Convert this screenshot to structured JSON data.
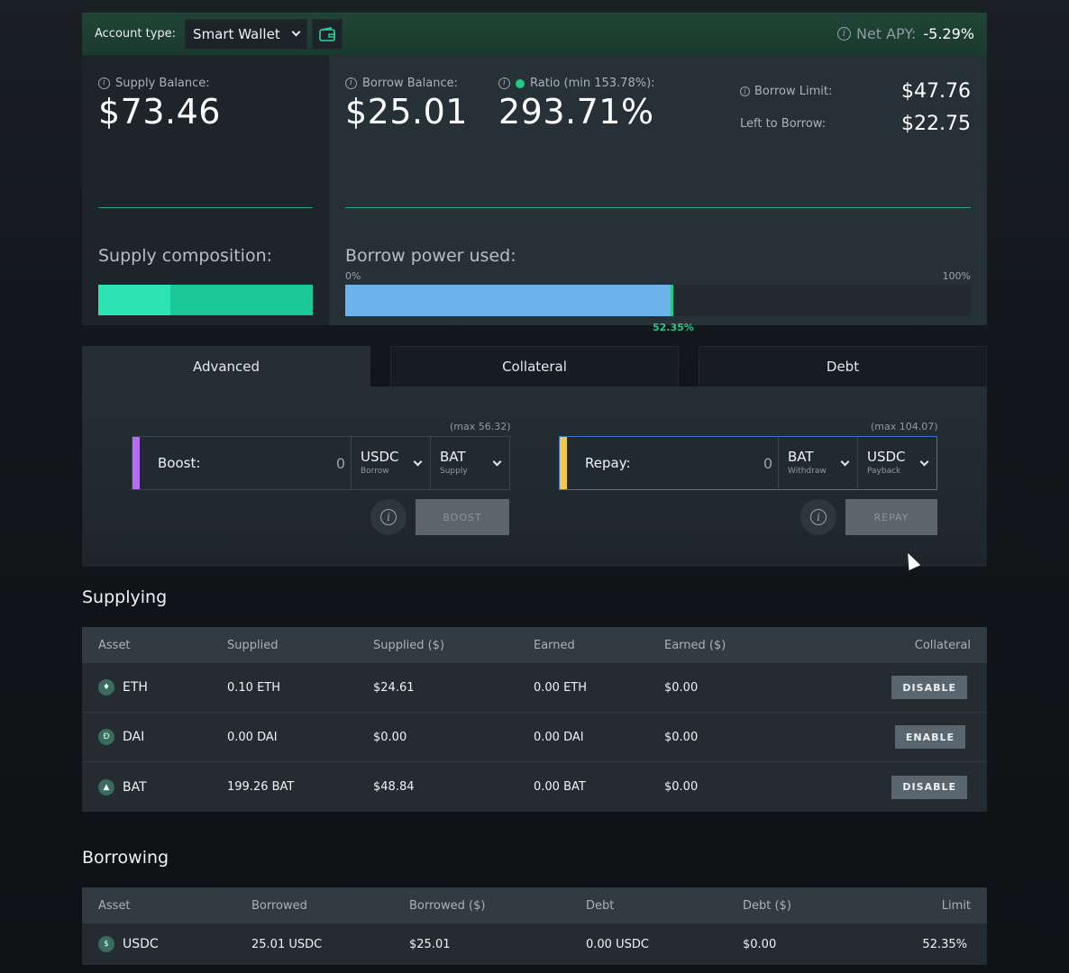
{
  "header": {
    "account_type_label": "Account type:",
    "account_type_value": "Smart Wallet",
    "net_apy_label": "Net APY:",
    "net_apy_value": "-5.29%"
  },
  "stats": {
    "supply_balance_label": "Supply Balance:",
    "supply_balance_value": "$73.46",
    "borrow_balance_label": "Borrow Balance:",
    "borrow_balance_value": "$25.01",
    "ratio_label": "Ratio (min 153.78%):",
    "ratio_value": "293.71%",
    "borrow_limit_label": "Borrow Limit:",
    "borrow_limit_value": "$47.76",
    "left_to_borrow_label": "Left to Borrow:",
    "left_to_borrow_value": "$22.75",
    "supply_composition_label": "Supply composition:",
    "borrow_power_label": "Borrow power used:",
    "borrow_power_min": "0%",
    "borrow_power_max": "100%",
    "borrow_power_value": "52.35%",
    "borrow_power_fraction": 0.5235,
    "supply_composition_fraction_first": 0.335
  },
  "tabs": [
    {
      "label": "Advanced",
      "active": true
    },
    {
      "label": "Collateral",
      "active": false
    },
    {
      "label": "Debt",
      "active": false
    }
  ],
  "boost": {
    "label": "Boost:",
    "amount": "0",
    "max_label": "(max 56.32)",
    "from_asset": "USDC",
    "from_sub": "Borrow",
    "to_asset": "BAT",
    "to_sub": "Supply",
    "button": "BOOST",
    "accent": "#b76cf5"
  },
  "repay": {
    "label": "Repay:",
    "amount": "0",
    "max_label": "(max 104.07)",
    "from_asset": "BAT",
    "from_sub": "Withdraw",
    "to_asset": "USDC",
    "to_sub": "Payback",
    "button": "REPAY",
    "accent": "#f2c94c"
  },
  "supplying": {
    "title": "Supplying",
    "columns": [
      "Asset",
      "Supplied",
      "Supplied ($)",
      "Earned",
      "Earned ($)",
      "Collateral"
    ],
    "rows": [
      {
        "asset": "ETH",
        "icon": "eth-icon",
        "supplied": "0.10 ETH",
        "supplied_usd": "$24.61",
        "earned": "0.00 ETH",
        "earned_usd": "$0.00",
        "action": "DISABLE"
      },
      {
        "asset": "DAI",
        "icon": "dai-icon",
        "supplied": "0.00 DAI",
        "supplied_usd": "$0.00",
        "earned": "0.00 DAI",
        "earned_usd": "$0.00",
        "action": "ENABLE"
      },
      {
        "asset": "BAT",
        "icon": "bat-icon",
        "supplied": "199.26 BAT",
        "supplied_usd": "$48.84",
        "earned": "0.00 BAT",
        "earned_usd": "$0.00",
        "action": "DISABLE"
      }
    ]
  },
  "borrowing": {
    "title": "Borrowing",
    "columns": [
      "Asset",
      "Borrowed",
      "Borrowed ($)",
      "Debt",
      "Debt ($)",
      "Limit"
    ],
    "rows": [
      {
        "asset": "USDC",
        "icon": "usdc-icon",
        "borrowed": "25.01 USDC",
        "borrowed_usd": "$25.01",
        "debt": "0.00 USDC",
        "debt_usd": "$0.00",
        "limit": "52.35%"
      }
    ]
  }
}
